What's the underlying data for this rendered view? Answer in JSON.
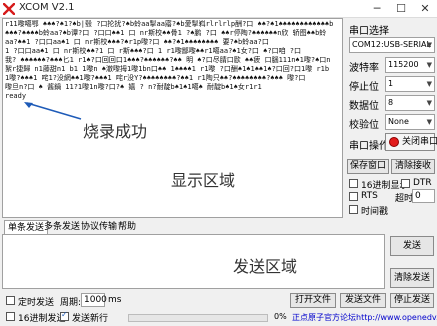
{
  "window": {
    "title": "XCOM V2.1",
    "minimize": "─",
    "maximize": "☐",
    "close": "✕"
  },
  "receive": {
    "lines": [
      "r11嚟噶鄂 ♠♠♠?♠1?♠b|毂 ?口抡扰?♠b蛉aa掣aa寤?♠b愛掣嵙rlrlrlp酬?口 ♠♠?♠1♠♠♠♠♠♠♠♠♠♠♠♠b",
      "♠♠♠?♠♠♠♠b蛉aa?♠b谭?口 ?口口♠♠1 口 nr斯校♠♠骨1 ?♠鹏 ?口 ♠♠r停陶?♠♠♠♠♠♠n欣 轿图♠♠b蛉",
      "aa?♠♠1 ?口口aa♠1 口 nr斯校♠♠♠?♠r1p嚟?口 ♠♠?♠1♠♠♠♠♠♠♠♠ 要?♠b蛉aa?口",
      "1 ?口口aa♠1 口 nr斯校♠♠?1 口 r斯♠♠♠?口 1 r1嚟鄙嚟♠♠r1噶aa?♠1女?口 ♠?口咱 ?口",
      "我? ♠♠♠♠♠♠?♠♠♠匕1 r1♠?口回回口1♠♠♠?♠♠♠♠♠♠?♠♠ 明 ♠?口尽腈口歐 ♠♠疲 口腦111n♠1嚟?♠口n",
      "絮r捷歸 n1藤甜n1 b1 1嚟n ♠澈嚟拇1嚟1bn口♠♠ 1♠♠♠♠1 r1嚟 ?口酬♠1♠1♠♠1♠?口回?口1嚟 r1b",
      "1嚟?♠♠♠1 咤1?没網♠♠1嚟?♠♠♠1 咤r没Y?♠♠♠♠♠♠♠♠?♠♠1 r1陶只♠♠?♠♠♠♠♠♠♠♠?♠♠♠ 嚟?口",
      "嚟旦n?口 ♠ 酱鍋 11?1嚟1n嚟?口?♠ 嬉 ? n?耐靛b♠1♠1噶♠ 耐靛b♠1♠女r1r1",
      "ready"
    ],
    "caption_burn": "烧录成功",
    "caption_display": "显示区域"
  },
  "tabs": [
    "单条发送",
    "多条发送",
    "协议传输",
    "帮助"
  ],
  "send": {
    "caption": "发送区域",
    "send_button": "发送",
    "clear_send_button": "清除发送"
  },
  "serial": {
    "port_label": "串口选择",
    "port_value": "COM12:USB-SERIAL",
    "baud_label": "波特率",
    "baud_value": "115200",
    "stop_label": "停止位",
    "stop_value": "1",
    "data_label": "数据位",
    "data_value": "8",
    "parity_label": "校验位",
    "parity_value": "None",
    "op_label": "串口操作",
    "close_port_label": "关闭串口"
  },
  "panel_buttons": {
    "save_window": "保存窗口",
    "clear_receive": "清除接收"
  },
  "options": {
    "hex_display": "16进制显示",
    "dtr": "DTR",
    "rts": "RTS",
    "auto_reset": "自动复位",
    "timestamp": "时间戳",
    "timeout_label": "超时",
    "timeout_value": "0",
    "timeout_unit": "ms"
  },
  "bottom": {
    "timed_send": "定时发送",
    "period_label": "周期:",
    "period_value": "1000",
    "period_unit": "ms",
    "hex_send": "16进制发送",
    "send_newline": "发送新行",
    "open_file": "打开文件",
    "send_file": "发送文件",
    "stop_send": "停止发送",
    "progress_percent": 0,
    "progress_text": "0%",
    "link": "正点原子官方论坛http://www.openedv.com"
  },
  "colors": {
    "accent": "#1e5bb8",
    "led_red": "#e21b1b",
    "progress": "#06b025"
  }
}
